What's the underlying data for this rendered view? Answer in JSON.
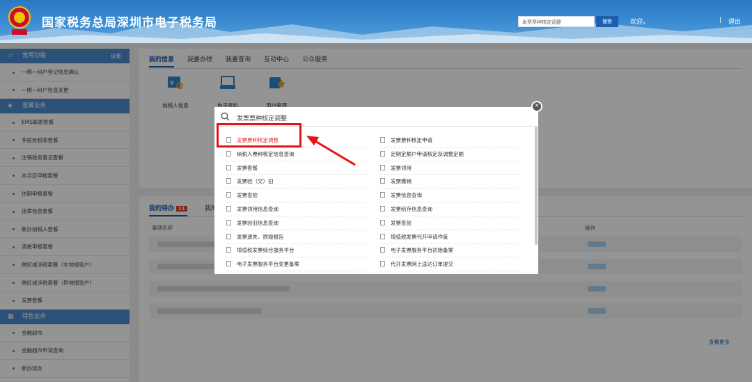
{
  "header": {
    "title": "国家税务总局深圳市电子税务局",
    "search_value": "发票票种核定调整",
    "search_button": "搜索",
    "welcome": "欢迎，",
    "separator": "|",
    "logout": "退出"
  },
  "sidebar": {
    "sections": [
      {
        "title": "常用功能",
        "icon": "star-icon",
        "settings": "设置",
        "items": [
          "一照一码户登记信息确认",
          "一照一码户信息变更"
        ]
      },
      {
        "title": "套餐业务",
        "icon": "stack-icon",
        "items": [
          "EMS邮寄套餐",
          "非居民税收套餐",
          "注销税务登记套餐",
          "本月应申报套餐",
          "往期申报套餐",
          "违章信息套餐",
          "新办纳税人套餐",
          "清税申报套餐",
          "跨区域涉税套餐（本地报验户）",
          "跨区域涉税套餐（异地报验户）",
          "发票套餐"
        ]
      },
      {
        "title": "特色业务",
        "icon": "grid-icon",
        "items": [
          "金融超市",
          "金融超市申请查询",
          "新办续办"
        ]
      }
    ]
  },
  "main": {
    "tabs": [
      "我的信息",
      "我要办税",
      "我要查询",
      "互动中心",
      "公众服务"
    ],
    "functions": [
      "纳税人信息",
      "电子资料",
      "用户管理"
    ],
    "todo_tab": "我的待办",
    "todo_count": "11",
    "todo_tab2": "我的",
    "col_name": "事项名称",
    "col_action": "操作",
    "more": "查看更多"
  },
  "modal": {
    "search_text": "发票票种核定调整",
    "results_left": [
      "发票票种核定调整",
      "纳税人票种核定信息查询",
      "发票套餐",
      "发票验（交）旧",
      "发票查验",
      "发票领用信息查询",
      "发票验旧信息查询",
      "发票遗失、损毁报告",
      "增值税发票综合服务平台",
      "电子发票服务平台变更备案"
    ],
    "results_right": [
      "发票票种核定申请",
      "定期定额户申请核定及调整定额",
      "发票领用",
      "发票缴销",
      "发票信息查询",
      "发票结存信息查询",
      "发票查验",
      "增值税发票代开申请作废",
      "电子发票服务平台初始备案",
      "代开发票网上送达订单提交"
    ],
    "highlight_color": "#e21414"
  }
}
